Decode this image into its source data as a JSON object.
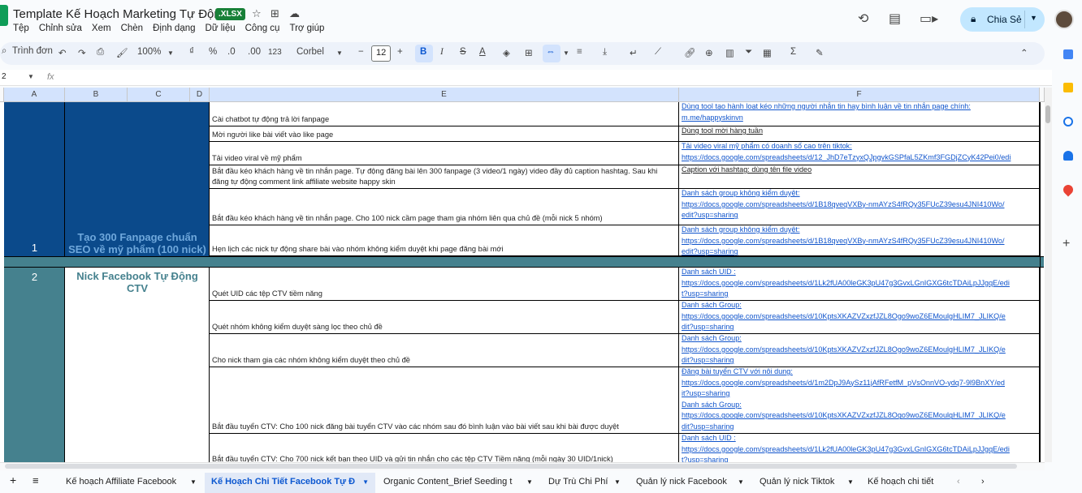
{
  "app": {
    "doc_title": "Template Kế Hoạch Marketing Tự Động",
    "badge": ".XLSX",
    "menus": [
      "Tệp",
      "Chỉnh sửa",
      "Xem",
      "Chèn",
      "Định dạng",
      "Dữ liệu",
      "Công cụ",
      "Trợ giúp"
    ],
    "share_label": "Chia Sẻ"
  },
  "toolbar": {
    "search_label": "Trình đơn",
    "zoom": "100%",
    "currency": "₫",
    "percent": "%",
    "dec_less": ".0",
    "dec_more": ".00",
    "format_123": "123",
    "font": "Corbel",
    "font_size": "12",
    "bold": "B",
    "italic": "I",
    "strike": "S",
    "text_color": "A"
  },
  "formula": {
    "cell_ref": "2",
    "fx": "fx"
  },
  "columns": [
    "A",
    "B",
    "C",
    "D",
    "E",
    "F"
  ],
  "stages": [
    {
      "number": "1",
      "title": "Tạo 300 Fanpage chuẩn SEO về mỹ phẩm (100 nick)"
    },
    {
      "number": "2",
      "title": "Nick Facebook Tự Động CTV"
    }
  ],
  "rows": [
    {
      "task": "Cài chatbot tự động trả lời fanpage",
      "notes": [
        "Dùng tool tạo hành loạt kéo những người nhắn tin hay bình luận về tin nhắn page chính:",
        "m.me/happyskinvn"
      ],
      "black": false
    },
    {
      "task": "Mời người like bài viết vào like page",
      "notes": [
        "Dùng tool mời hàng tuần"
      ],
      "black": true
    },
    {
      "task": "Tải video viral về mỹ phẩm",
      "notes": [
        "Tải video viral mỹ phẩm có doanh số cao trên tiktok:",
        "https://docs.google.com/spreadsheets/d/12_JhD7eTzyxQJpgvkGSPfaL5ZKmf3FGDjZCyK42Pei0/edi",
        "t?usp=sharing"
      ],
      "black": false
    },
    {
      "task": "Bắt đầu kéo khách hàng về tin nhắn page. Tự động đăng bài lên 300 fanpage (3 video/1 ngày) video đầy đủ caption hashtag. Sau khi đăng tự động comment link affiliate website happy skin",
      "notes": [
        "Caption với hashtag: dùng tên file video"
      ],
      "black": true
    },
    {
      "task": "Bắt đầu kéo khách hàng về tin nhắn page. Cho 100 nick cầm page tham gia nhóm liên qua chủ đề (mỗi nick 5 nhóm)",
      "notes": [
        "Danh sách group không kiểm duyệt:",
        "https://docs.google.com/spreadsheets/d/1B18qveqVXBy-nmAYzS4fRQy35FUcZ39esu4JNI410Wo/",
        "edit?usp=sharing"
      ],
      "black": false
    },
    {
      "task": "Hẹn lịch các nick tự động share bài vào nhóm không kiểm duyệt khi page đăng bài mới",
      "notes": [
        "Danh sách group không kiểm duyệt:",
        "https://docs.google.com/spreadsheets/d/1B18qveqVXBy-nmAYzS4fRQy35FUcZ39esu4JNI410Wo/",
        "edit?usp=sharing"
      ],
      "black": false
    },
    {
      "task": "Quét UID các tệp CTV tiềm năng",
      "notes": [
        "Danh sách UID :",
        "https://docs.google.com/spreadsheets/d/1Lk2fUA00leGK3pU47g3GvxLGnIGXG6tcTDAiLpJJgqE/edi",
        "t?usp=sharing"
      ],
      "black": false
    },
    {
      "task": "Quét nhóm không kiểm duyệt sàng lọc theo chủ đề",
      "notes": [
        "Danh sách Group:",
        "https://docs.google.com/spreadsheets/d/10KptsXKAZVZxzfJZL8Ogo9woZ6EMoulgHLIM7_JLIKQ/e",
        "dit?usp=sharing"
      ],
      "black": false
    },
    {
      "task": "Cho nick tham gia các nhóm không kiểm duyệt theo chủ đề",
      "notes": [
        "Danh sách Group:",
        "https://docs.google.com/spreadsheets/d/10KptsXKAZVZxzfJZL8Ogo9woZ6EMoulgHLIM7_JLIKQ/e",
        "dit?usp=sharing"
      ],
      "black": false
    },
    {
      "task": "Bắt đầu tuyển CTV: Cho 100 nick đăng bài tuyển CTV vào các nhóm sau đó bình luận vào bài viết sau khi bài được duyệt",
      "notes": [
        "Đăng bài tuyển CTV với nôi dung:",
        "https://docs.google.com/spreadsheets/d/1m2DpJ9AySz11jAfRFetfM_pVsOnnVO-ydq7-9l9BnXY/ed",
        "it?usp=sharing",
        "Danh sách Group:",
        "https://docs.google.com/spreadsheets/d/10KptsXKAZVZxzfJZL8Ogo9woZ6EMoulgHLIM7_JLIKQ/e",
        "dit?usp=sharing"
      ],
      "black": false
    },
    {
      "task": "Bắt đầu tuyển CTV: Cho 700 nick kết bạn theo UID và gửi tin nhắn cho các tệp CTV Tiềm năng (mỗi ngày 30 UID/1nick)",
      "notes": [
        "Danh sách UID :",
        "https://docs.google.com/spreadsheets/d/1Lk2fUA00leGK3pU47g3GvxLGnIGXG6tcTDAiLpJJgqE/edi",
        "t?usp=sharing"
      ],
      "black": false
    }
  ],
  "sheet_tabs": [
    "Kế hoạch Affiliate Facebook",
    "Kế Hoạch Chi Tiết Facebook Tự Đ",
    "Organic Content_Brief Seeding t",
    "Dự Trù Chi Phí",
    "Quản lý nick Facebook",
    "Quản lý nick Tiktok",
    "Kế hoạch chi tiết"
  ],
  "colors": {
    "stage1_bg": "#0b4a8b",
    "stage2_bg": "#45818e",
    "stage1_title": "#6fa8dc",
    "stage2_title": "#45818e",
    "link": "#1155cc",
    "share_bg": "#c2e7ff"
  }
}
